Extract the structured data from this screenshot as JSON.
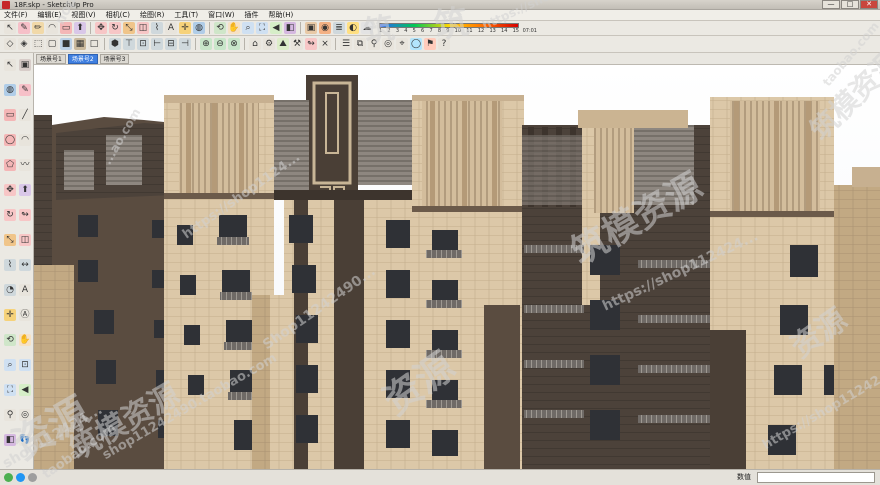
{
  "window": {
    "title": "18F.skp - SketchUp Pro",
    "minimize_label": "—",
    "maximize_label": "□",
    "close_label": "✕"
  },
  "menu": [
    {
      "label": "文件(F)"
    },
    {
      "label": "编辑(E)"
    },
    {
      "label": "视图(V)"
    },
    {
      "label": "相机(C)"
    },
    {
      "label": "绘图(R)"
    },
    {
      "label": "工具(T)"
    },
    {
      "label": "窗口(W)"
    },
    {
      "label": "插件"
    },
    {
      "label": "帮助(H)"
    }
  ],
  "scenes": [
    {
      "label": "场景号1"
    },
    {
      "label": "场景号2"
    },
    {
      "label": "场景号3"
    }
  ],
  "toolbar_row1": [
    {
      "icon": "select-arrow-icon",
      "glyph": "↖",
      "color": "#e8e4dc"
    },
    {
      "icon": "eraser-icon",
      "glyph": "✎",
      "color": "#f6c0c8"
    },
    {
      "icon": "pencil-icon",
      "glyph": "✏",
      "color": "#f1d9a8"
    },
    {
      "icon": "arc-icon",
      "glyph": "◠",
      "color": "#e8e4dc"
    },
    {
      "icon": "shapes-icon",
      "glyph": "▭",
      "color": "#f4b6b6"
    },
    {
      "icon": "push-pull-icon",
      "glyph": "⬆",
      "color": "#d9c7e8"
    },
    {
      "icon": "move-icon",
      "glyph": "✥",
      "color": "#f7c6c6"
    },
    {
      "icon": "rotate-icon",
      "glyph": "↻",
      "color": "#f7c6c6"
    },
    {
      "icon": "scale-icon",
      "glyph": "⤡",
      "color": "#f0c58a"
    },
    {
      "icon": "offset-icon",
      "glyph": "◫",
      "color": "#f7c6c6"
    },
    {
      "icon": "tape-measure-icon",
      "glyph": "⌇",
      "color": "#cfd8dc"
    },
    {
      "icon": "text-icon",
      "glyph": "A",
      "color": "#e8e4dc"
    },
    {
      "icon": "axes-icon",
      "glyph": "✛",
      "color": "#f6d27a"
    },
    {
      "icon": "paint-bucket-icon",
      "glyph": "◍",
      "color": "#b0cde8"
    },
    {
      "icon": "orbit-icon",
      "glyph": "⟲",
      "color": "#cfe6c9"
    },
    {
      "icon": "pan-icon",
      "glyph": "✋",
      "color": "#f6e1c4"
    },
    {
      "icon": "zoom-icon",
      "glyph": "⌕",
      "color": "#cfe0f2"
    },
    {
      "icon": "zoom-extents-icon",
      "glyph": "⛶",
      "color": "#cfe0f2"
    },
    {
      "icon": "previous-view-icon",
      "glyph": "◀",
      "color": "#d6eec8"
    },
    {
      "icon": "section-plane-icon",
      "glyph": "◧",
      "color": "#d5b8e0"
    },
    {
      "icon": "components-icon",
      "glyph": "▣",
      "color": "#e8c9a6"
    },
    {
      "icon": "materials-icon",
      "glyph": "◉",
      "color": "#f4b183"
    },
    {
      "icon": "layers-icon",
      "glyph": "≣",
      "color": "#cfd8dc"
    },
    {
      "icon": "shadows-icon",
      "glyph": "◐",
      "color": "#ffe082"
    },
    {
      "icon": "fog-icon",
      "glyph": "☁",
      "color": "#e3e3e3"
    }
  ],
  "scale_bar": {
    "ticks": [
      "1",
      "2",
      "3",
      "4",
      "5",
      "6",
      "7",
      "8",
      "9",
      "10",
      "11",
      "12",
      "13",
      "14",
      "15"
    ],
    "max_label": "07:01"
  },
  "toolbar_row2": [
    {
      "icon": "style-xray-icon",
      "glyph": "◇",
      "color": "#e8e4dc"
    },
    {
      "icon": "style-backedges-icon",
      "glyph": "◈",
      "color": "#e8e4dc"
    },
    {
      "icon": "style-wireframe-icon",
      "glyph": "⬚",
      "color": "#e8e4dc"
    },
    {
      "icon": "style-hidden-line-icon",
      "glyph": "▢",
      "color": "#e8e4dc"
    },
    {
      "icon": "style-shaded-icon",
      "glyph": "■",
      "color": "#bcd0e6"
    },
    {
      "icon": "style-textured-icon",
      "glyph": "▦",
      "color": "#c9b89c"
    },
    {
      "icon": "style-monochrome-icon",
      "glyph": "□",
      "color": "#e8e4dc"
    },
    {
      "icon": "view-iso-icon",
      "glyph": "⬢",
      "color": "#cfd8dc"
    },
    {
      "icon": "view-top-icon",
      "glyph": "⊤",
      "color": "#cfd8dc"
    },
    {
      "icon": "view-front-icon",
      "glyph": "⊡",
      "color": "#cfd8dc"
    },
    {
      "icon": "view-right-icon",
      "glyph": "⊢",
      "color": "#cfd8dc"
    },
    {
      "icon": "view-back-icon",
      "glyph": "⊟",
      "color": "#cfd8dc"
    },
    {
      "icon": "view-left-icon",
      "glyph": "⊣",
      "color": "#cfd8dc"
    },
    {
      "icon": "solid-union-icon",
      "glyph": "⊕",
      "color": "#c8e6c9"
    },
    {
      "icon": "solid-subtract-icon",
      "glyph": "⊖",
      "color": "#c8e6c9"
    },
    {
      "icon": "solid-intersect-icon",
      "glyph": "⊗",
      "color": "#c8e6c9"
    },
    {
      "icon": "warehouse-icon",
      "glyph": "⌂",
      "color": "#e8e4dc"
    },
    {
      "icon": "extension-icon",
      "glyph": "⚙",
      "color": "#e8e4dc"
    },
    {
      "icon": "sandbox-icon",
      "glyph": "⛰",
      "color": "#dcedc8"
    },
    {
      "icon": "dynamic-component-icon",
      "glyph": "⚒",
      "color": "#e8e4dc"
    },
    {
      "icon": "follow-me-icon",
      "glyph": "↬",
      "color": "#f7c6c6"
    },
    {
      "icon": "intersect-faces-icon",
      "glyph": "⨯",
      "color": "#e8e4dc"
    },
    {
      "icon": "outliner-icon",
      "glyph": "☰",
      "color": "#e8e4dc"
    },
    {
      "icon": "photo-match-icon",
      "glyph": "⧉",
      "color": "#e8e4dc"
    },
    {
      "icon": "walk-icon",
      "glyph": "⚲",
      "color": "#e8e4dc"
    },
    {
      "icon": "look-around-icon",
      "glyph": "◎",
      "color": "#e8e4dc"
    },
    {
      "icon": "position-camera-icon",
      "glyph": "⌖",
      "color": "#e8e4dc"
    },
    {
      "icon": "google-earth-icon",
      "glyph": "◯",
      "color": "#b3e5fc"
    },
    {
      "icon": "geo-location-icon",
      "glyph": "⚑",
      "color": "#ffccbc"
    },
    {
      "icon": "help-icon",
      "glyph": "?",
      "color": "#e8e4dc"
    }
  ],
  "left_tools": [
    {
      "icon": "select-tool-icon",
      "glyph": "↖"
    },
    {
      "icon": "make-component-tool-icon",
      "glyph": "▣"
    },
    {
      "icon": "paint-tool-icon",
      "glyph": "◍"
    },
    {
      "icon": "eraser-tool-icon",
      "glyph": "✎"
    },
    {
      "icon": "rectangle-tool-icon",
      "glyph": "▭"
    },
    {
      "icon": "line-tool-icon",
      "glyph": "╱"
    },
    {
      "icon": "circle-tool-icon",
      "glyph": "◯"
    },
    {
      "icon": "arc-tool-icon",
      "glyph": "◠"
    },
    {
      "icon": "polygon-tool-icon",
      "glyph": "⬠"
    },
    {
      "icon": "freehand-tool-icon",
      "glyph": "〰"
    },
    {
      "icon": "move-tool-icon",
      "glyph": "✥"
    },
    {
      "icon": "push-pull-tool-icon",
      "glyph": "⬆"
    },
    {
      "icon": "rotate-tool-icon",
      "glyph": "↻"
    },
    {
      "icon": "follow-me-tool-icon",
      "glyph": "↬"
    },
    {
      "icon": "scale-tool-icon",
      "glyph": "⤡"
    },
    {
      "icon": "offset-tool-icon",
      "glyph": "◫"
    },
    {
      "icon": "tape-tool-icon",
      "glyph": "⌇"
    },
    {
      "icon": "dimension-tool-icon",
      "glyph": "↔"
    },
    {
      "icon": "protractor-tool-icon",
      "glyph": "◔"
    },
    {
      "icon": "text-tool-icon",
      "glyph": "A"
    },
    {
      "icon": "axes-tool-icon",
      "glyph": "✛"
    },
    {
      "icon": "3d-text-tool-icon",
      "glyph": "Ⓐ"
    },
    {
      "icon": "orbit-tool-icon",
      "glyph": "⟲"
    },
    {
      "icon": "pan-tool-icon",
      "glyph": "✋"
    },
    {
      "icon": "zoom-tool-icon",
      "glyph": "⌕"
    },
    {
      "icon": "zoom-window-tool-icon",
      "glyph": "⊡"
    },
    {
      "icon": "zoom-extents-tool-icon",
      "glyph": "⛶"
    },
    {
      "icon": "previous-tool-icon",
      "glyph": "◀"
    },
    {
      "icon": "walk-tool-icon",
      "glyph": "⚲"
    },
    {
      "icon": "look-around-tool-icon",
      "glyph": "◎"
    },
    {
      "icon": "section-tool-icon",
      "glyph": "◧"
    },
    {
      "icon": "footprints-tool-icon",
      "glyph": "👣"
    }
  ],
  "status": {
    "measurements_label": "数值",
    "measurements_value": "",
    "icons": [
      {
        "icon": "geo-location-status-icon",
        "color": "#4caf50"
      },
      {
        "icon": "credits-status-icon",
        "color": "#2196f3"
      },
      {
        "icon": "user-status-icon",
        "color": "#9e9e9e"
      }
    ]
  },
  "watermarks": [
    {
      "text": "筑"
    },
    {
      "text": "筑"
    },
    {
      "text": "https://shop"
    },
    {
      "text": "nop112424...taobao.com"
    },
    {
      "text": "资源"
    },
    {
      "text": "资源"
    },
    {
      "text": "shop112424..."
    },
    {
      "text": "筑模资源"
    },
    {
      "text": "https://shop112424..."
    },
    {
      "text": "shop11242490.taobao.com"
    },
    {
      "text": "筑模资源"
    },
    {
      "text": "...ao.com"
    },
    {
      "text": "https://shop1124..."
    },
    {
      "text": "Shop11242490..."
    },
    {
      "text": "资源"
    },
    {
      "text": "https://shop112424..."
    },
    {
      "text": "筑模资源"
    },
    {
      "text": "taobao.com"
    },
    {
      "text": "taobao.com"
    }
  ],
  "colors": {
    "facade_light": "#d9c4a4",
    "facade_mid": "#b69e7e",
    "facade_dark": "#4a3f36",
    "window_glass": "#3c3d42",
    "scene_active": "#3f7fe0"
  }
}
